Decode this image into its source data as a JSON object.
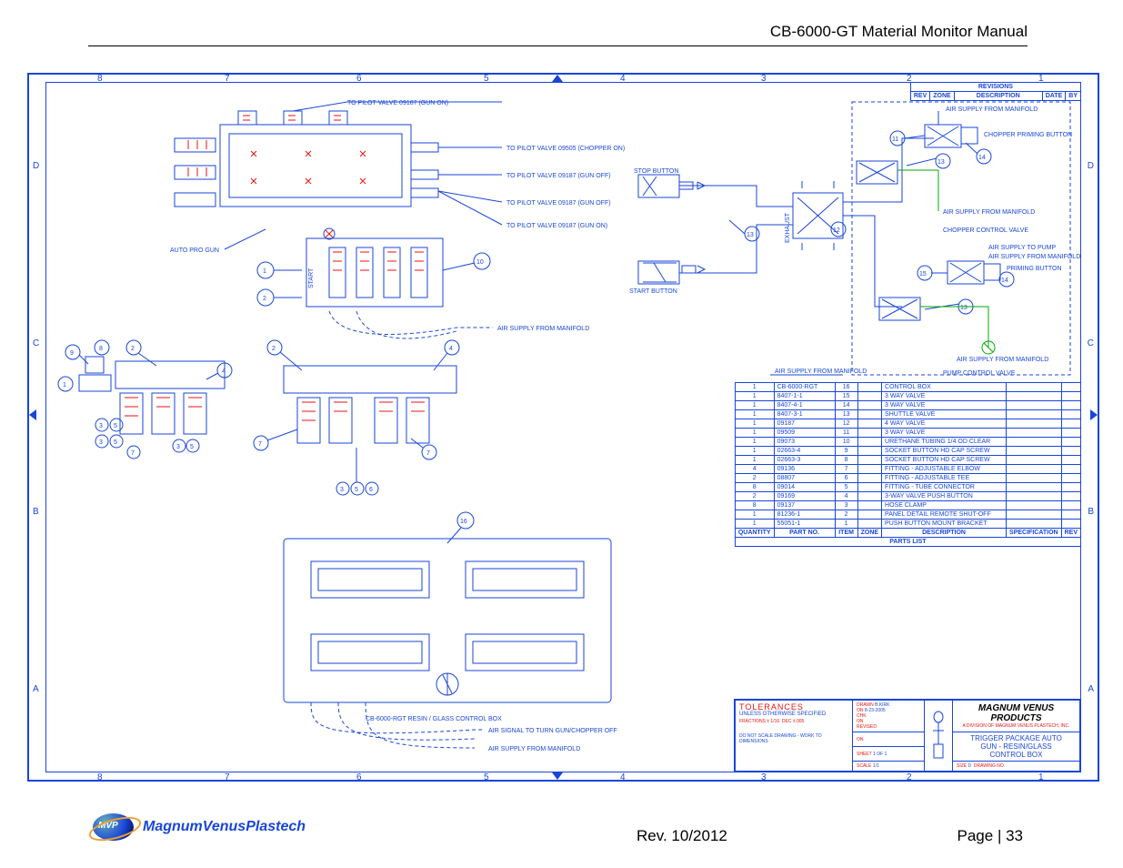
{
  "header": {
    "title": "CB-6000-GT Material Monitor Manual"
  },
  "footer": {
    "brand": "MagnumVenusPlastech",
    "rev": "Rev. 10/2012",
    "page": "Page | 33"
  },
  "grid": {
    "cols": [
      "8",
      "7",
      "6",
      "5",
      "4",
      "3",
      "2",
      "1"
    ],
    "rows": [
      "D",
      "C",
      "B",
      "A"
    ]
  },
  "revisions_header": [
    "REV",
    "ZONE",
    "DESCRIPTION",
    "DATE",
    "BY"
  ],
  "revisions_title": "REVISIONS",
  "callout_labels": {
    "to_pilot_valve_gun_on": "TO PILOT VALVE 09187 (GUN ON)",
    "to_pilot_valve_chopper_on": "TO PILOT VALVE 09505 (CHOPPER ON)",
    "to_pilot_valve_gun_off": "TO PILOT VALVE 09187 (GUN OFF)",
    "auto_pro_gun": "AUTO PRO GUN",
    "air_supply_from_manifold": "AIR SUPPLY FROM MANIFOLD",
    "stop_button": "STOP BUTTON",
    "start_button": "START BUTTON",
    "exhaust": "EXHAUST",
    "chopper_priming_button": "CHOPPER PRIMING BUTTON",
    "chopper_control_valve": "CHOPPER CONTROL VALVE",
    "air_supply_to_pump": "AIR SUPPLY TO PUMP",
    "priming_button": "PRIMING BUTTON",
    "pump_control_valve": "PUMP CONTROL VALVE",
    "control_box_label": "CB-6000-RGT RESIN / GLASS CONTROL BOX",
    "air_signal_off": "AIR SIGNAL TO TURN GUN/CHOPPER OFF",
    "start_text": "START"
  },
  "parts_list_title": "PARTS LIST",
  "parts_list_headers": [
    "QUANTITY",
    "PART NO.",
    "ITEM",
    "ZONE",
    "DESCRIPTION",
    "SPECIFICATION",
    "REV"
  ],
  "parts_list": [
    {
      "qty": "1",
      "pn": "CB-6000-RGT",
      "item": "16",
      "desc": "CONTROL BOX"
    },
    {
      "qty": "1",
      "pn": "8407-1-1",
      "item": "15",
      "desc": "3 WAY VALVE"
    },
    {
      "qty": "1",
      "pn": "8407-4-1",
      "item": "14",
      "desc": "3 WAY VALVE"
    },
    {
      "qty": "1",
      "pn": "8407-3-1",
      "item": "13",
      "desc": "SHUTTLE VALVE"
    },
    {
      "qty": "1",
      "pn": "09187",
      "item": "12",
      "desc": "4 WAY VALVE"
    },
    {
      "qty": "1",
      "pn": "09509",
      "item": "11",
      "desc": "3 WAY VALVE"
    },
    {
      "qty": "1",
      "pn": "09073",
      "item": "10",
      "desc": "URETHANE TUBING 1/4 OD CLEAR"
    },
    {
      "qty": "1",
      "pn": "02663-4",
      "item": "9",
      "desc": "SOCKET BUTTON HD CAP SCREW"
    },
    {
      "qty": "1",
      "pn": "02663-3",
      "item": "8",
      "desc": "SOCKET BUTTON HD CAP SCREW"
    },
    {
      "qty": "4",
      "pn": "09136",
      "item": "7",
      "desc": "FITTING - ADJUSTABLE ELBOW"
    },
    {
      "qty": "2",
      "pn": "08807",
      "item": "6",
      "desc": "FITTING - ADJUSTABLE TEE"
    },
    {
      "qty": "8",
      "pn": "09014",
      "item": "5",
      "desc": "FITTING - TUBE CONNECTOR"
    },
    {
      "qty": "2",
      "pn": "09169",
      "item": "4",
      "desc": "3-WAY VALVE PUSH BUTTON"
    },
    {
      "qty": "8",
      "pn": "09137",
      "item": "3",
      "desc": "HOSE CLAMP"
    },
    {
      "qty": "1",
      "pn": "81236-1",
      "item": "2",
      "desc": "PANEL DETAIL REMOTE SHUT-OFF"
    },
    {
      "qty": "1",
      "pn": "55051-1",
      "item": "1",
      "desc": "PUSH BUTTON MOUNT BRACKET"
    }
  ],
  "title_block": {
    "tolerances_label": "TOLERANCES",
    "tolerances_sub": "UNLESS OTHERWISE SPECIFIED",
    "noscale": "DO NOT SCALE DRAWING - WORK TO DIMENSIONS",
    "company": "MAGNUM VENUS PRODUCTS",
    "drawing_title_1": "TRIGGER PACKAGE AUTO",
    "drawing_title_2": "GUN - RESIN/GLASS",
    "drawing_title_3": "CONTROL BOX",
    "date": "8-23-2005",
    "sheet": "1 OF 1",
    "scale": "1/1"
  }
}
